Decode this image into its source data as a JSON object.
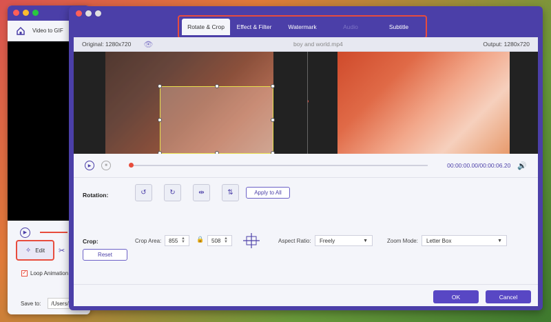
{
  "background_window": {
    "tool_label": "Video to GIF",
    "edit_label": "Edit",
    "loop_label": "Loop Animation",
    "save_to_label": "Save to:",
    "save_path": "/Users/"
  },
  "editor": {
    "tabs": [
      {
        "label": "Rotate & Crop",
        "state": "active"
      },
      {
        "label": "Effect & Filter",
        "state": "normal"
      },
      {
        "label": "Watermark",
        "state": "normal"
      },
      {
        "label": "Audio",
        "state": "disabled"
      },
      {
        "label": "Subtitle",
        "state": "normal"
      }
    ],
    "original_label": "Original: 1280x720",
    "filename": "boy and world.mp4",
    "output_label": "Output: 1280x720",
    "time_display": "00:00:00.00/00:00:06.20",
    "rotation_label": "Rotation:",
    "apply_all_label": "Apply to All",
    "crop_label": "Crop:",
    "crop_area_label": "Crop Area:",
    "crop_width": "855",
    "crop_height": "508",
    "aspect_ratio_label": "Aspect Ratio:",
    "aspect_ratio_value": "Freely",
    "zoom_mode_label": "Zoom Mode:",
    "zoom_mode_value": "Letter Box",
    "reset_label": "Reset",
    "ok_label": "OK",
    "cancel_label": "Cancel"
  },
  "icons": {
    "rotate_left": "rotate-left-icon",
    "rotate_right": "rotate-right-icon",
    "flip_horizontal": "flip-horizontal-icon",
    "flip_vertical": "flip-vertical-icon"
  },
  "colors": {
    "accent": "#4b3fa8",
    "highlight": "#e84c3d",
    "button": "#5847c4"
  }
}
